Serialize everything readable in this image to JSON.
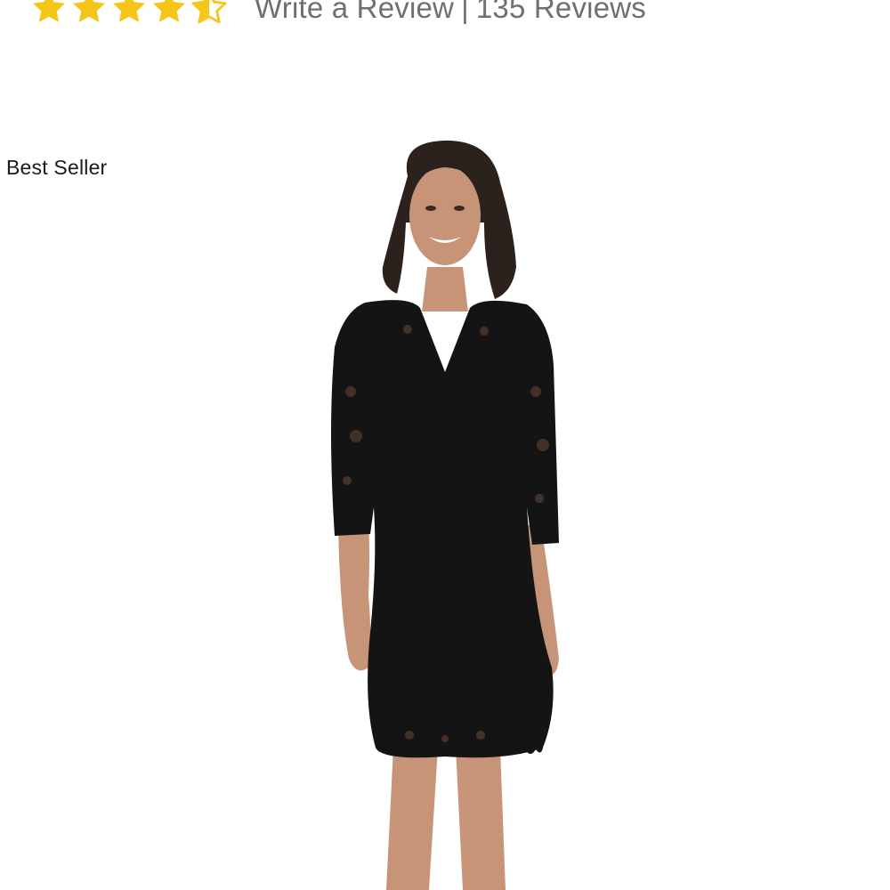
{
  "rating": {
    "value": 4.5,
    "max": 5,
    "star_color": "#f5c518",
    "write_review_label": "Write a Review",
    "separator": "|",
    "reviews_count_label": "135 Reviews"
  },
  "badge": {
    "label": "Best Seller"
  },
  "product_image": {
    "description_icon": "black-lace-dress-photo",
    "dress_color": "#141414",
    "skin_color": "#c79477",
    "hair_color": "#2b211d"
  }
}
